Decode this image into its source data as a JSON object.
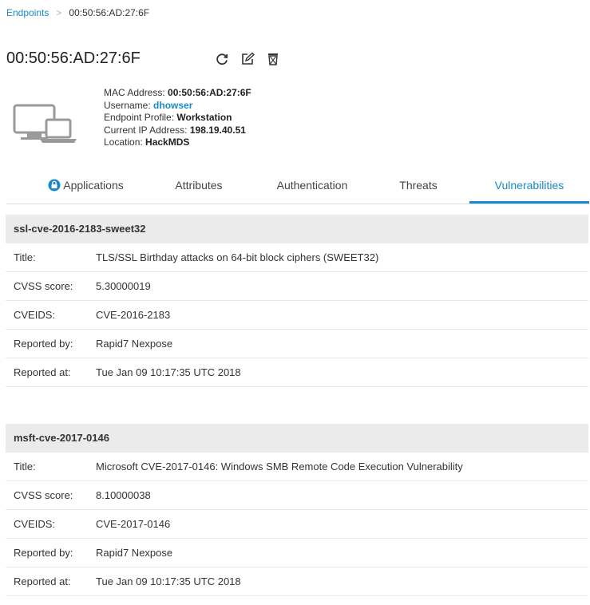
{
  "breadcrumb": {
    "root": "Endpoints",
    "separator": ">",
    "current": "00:50:56:AD:27:6F"
  },
  "header": {
    "title": "00:50:56:AD:27:6F"
  },
  "actions": [
    {
      "name": "refresh-icon"
    },
    {
      "name": "edit-icon"
    },
    {
      "name": "delete-icon"
    }
  ],
  "info": {
    "mac_label": "MAC Address: ",
    "mac_value": "00:50:56:AD:27:6F",
    "user_label": "Username: ",
    "user_value": "dhowser",
    "profile_label": "Endpoint Profile: ",
    "profile_value": "Workstation",
    "ip_label": "Current IP Address: ",
    "ip_value": "198.19.40.51",
    "location_label": "Location: ",
    "location_value": "HackMDS"
  },
  "tabs": [
    "Applications",
    "Attributes",
    "Authentication",
    "Threats",
    "Vulnerabilities"
  ],
  "active_tab": "Vulnerabilities",
  "vulnerabilities": [
    {
      "id": "ssl-cve-2016-2183-sweet32",
      "fields": [
        {
          "label": "Title:",
          "value": "TLS/SSL Birthday attacks on 64-bit block ciphers (SWEET32)"
        },
        {
          "label": "CVSS score:",
          "value": "5.30000019"
        },
        {
          "label": "CVEIDS:",
          "value": "CVE-2016-2183"
        },
        {
          "label": "Reported by:",
          "value": "Rapid7 Nexpose"
        },
        {
          "label": "Reported at:",
          "value": "Tue Jan 09 10:17:35 UTC 2018"
        }
      ]
    },
    {
      "id": "msft-cve-2017-0146",
      "fields": [
        {
          "label": "Title:",
          "value": "Microsoft CVE-2017-0146: Windows SMB Remote Code Execution Vulnerability"
        },
        {
          "label": "CVSS score:",
          "value": "8.10000038"
        },
        {
          "label": "CVEIDS:",
          "value": "CVE-2017-0146"
        },
        {
          "label": "Reported by:",
          "value": "Rapid7 Nexpose"
        },
        {
          "label": "Reported at:",
          "value": "Tue Jan 09 10:17:35 UTC 2018"
        }
      ]
    }
  ],
  "colors": {
    "link": "#1a8ac6",
    "section_bg": "#ebebeb",
    "icon": "#333333"
  }
}
